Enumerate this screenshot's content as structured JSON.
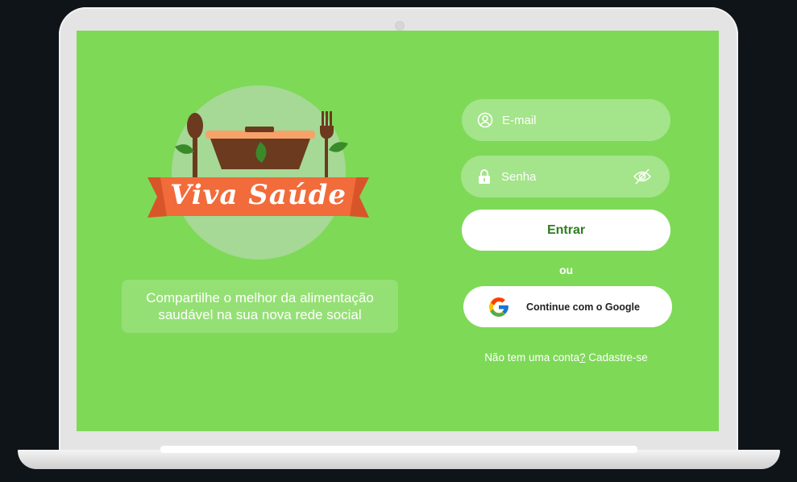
{
  "logo": {
    "text": "Viva Saúde"
  },
  "tagline": {
    "line1": "Compartilhe o melhor da alimentação",
    "line2": "saudável na sua nova rede social"
  },
  "login": {
    "email_placeholder": "E-mail",
    "password_placeholder": "Senha",
    "submit_label": "Entrar",
    "divider_text": "ou",
    "google_label": "Continue com o Google"
  },
  "signup": {
    "prefix": "Não tem uma conta",
    "question_mark": "?",
    "link_label": " Cadastre-se"
  },
  "colors": {
    "screen_bg": "#7ed957",
    "field_bg": "#a4e48a",
    "ribbon": "#f26b3a",
    "bowl": "#6b3a1f",
    "button_text": "#2e7d1f"
  },
  "icons": {
    "email": "user-circle-icon",
    "password": "lock-icon",
    "toggle_password": "eye-slash-icon",
    "google": "google-icon"
  }
}
